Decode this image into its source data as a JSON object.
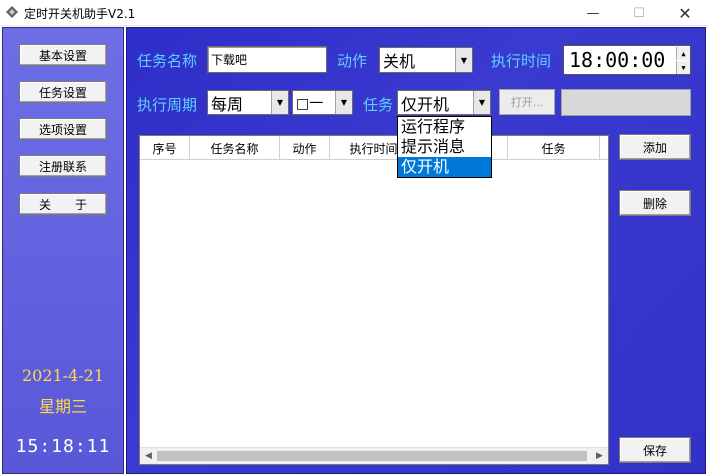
{
  "window": {
    "title": "定时开关机助手V2.1",
    "min_glyph": "—",
    "max_glyph": "☐",
    "close_glyph": "✕"
  },
  "sidebar": {
    "buttons": [
      {
        "label": "基本设置"
      },
      {
        "label": "任务设置"
      },
      {
        "label": "选项设置"
      },
      {
        "label": "注册联系"
      },
      {
        "label": "关　　于"
      }
    ],
    "date": "2021-4-21",
    "weekday": "星期三",
    "clock": "15:18:11"
  },
  "form": {
    "task_name_label": "任务名称",
    "task_name_value": "下载吧",
    "action_label": "动作",
    "action_value": "关机",
    "exec_time_label": "执行时间",
    "exec_time_value": "18:00:00",
    "period_label": "执行周期",
    "period_value": "每周",
    "day_value": "□一",
    "task_label": "任务",
    "task_value": "仅开机",
    "open_button": "打开...",
    "path_value": ""
  },
  "task_dropdown": {
    "options": [
      "运行程序",
      "提示消息",
      "仅开机"
    ],
    "selected_index": 2
  },
  "table": {
    "columns": [
      "序号",
      "任务名称",
      "动作",
      "执行时间",
      "",
      "任务"
    ],
    "rows": []
  },
  "actions": {
    "add": "添加",
    "delete": "删除",
    "save": "保存"
  },
  "colors": {
    "sidebar_bg": "#6464e0",
    "main_bg": "#3434cc",
    "label_cyan": "#5fd0ff",
    "date_yellow": "#ffd84a",
    "selection_blue": "#0078d7"
  }
}
